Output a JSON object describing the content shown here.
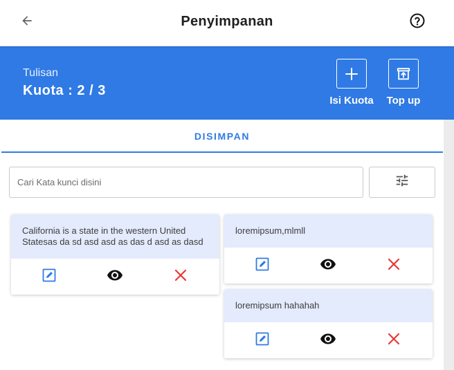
{
  "header": {
    "title": "Penyimpanan",
    "back_icon": "arrow-left-icon",
    "help_icon": "help-circle-icon"
  },
  "quota": {
    "type_label": "Tulisan",
    "value_label": "Kuota : 2 / 3",
    "actions": [
      {
        "label": "Isi Kuota",
        "icon": "plus-icon"
      },
      {
        "label": "Top up",
        "icon": "archive-upload-icon"
      }
    ]
  },
  "tabs": [
    {
      "label": "DISIMPAN",
      "active": true
    }
  ],
  "search": {
    "placeholder": "Cari Kata kunci disini",
    "value": ""
  },
  "filter_icon": "sliders-icon",
  "notes": [
    {
      "text": "California is a state in the western United Statesas da sd asd asd as das d asd as dasd"
    },
    {
      "text": "loremipsum,mlmll"
    },
    {
      "text": "loremipsum hahahah"
    }
  ],
  "note_actions": {
    "edit_icon": "edit-icon",
    "view_icon": "eye-icon",
    "delete_icon": "close-icon"
  },
  "colors": {
    "primary": "#2f7ae5",
    "card_highlight": "#e3ebfc",
    "edit": "#2f7ae5",
    "delete": "#e53935",
    "view": "#111111"
  }
}
